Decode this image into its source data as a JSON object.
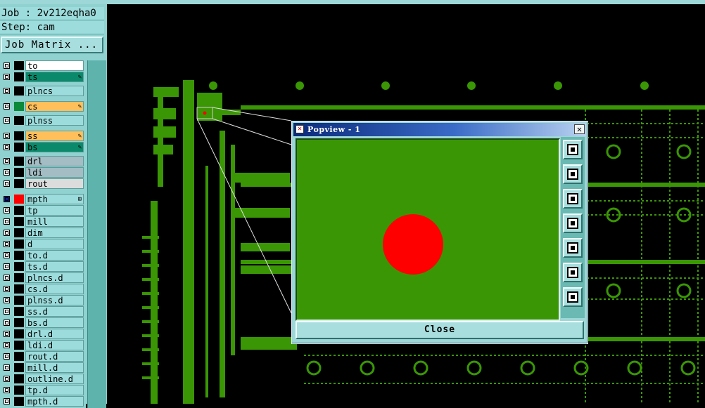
{
  "job_label": "Job : 2v212eqha0",
  "step_label": "Step: cam",
  "job_matrix_button": "Job Matrix ...",
  "layers": [
    {
      "name": "to",
      "bg": "#ffffff",
      "swatch": "#000000",
      "mark": ""
    },
    {
      "name": "ts",
      "bg": "#0a8a6a",
      "swatch": "#000000",
      "mark": "✎"
    },
    {
      "name": "plncs",
      "bg": "#9ddcdc",
      "swatch": "#000000",
      "mark": ""
    },
    {
      "name": "cs",
      "bg": "#ffbf5a",
      "swatch": "#0a8a3a",
      "mark": "✎"
    },
    {
      "name": "plnss",
      "bg": "#9ddcdc",
      "swatch": "#000000",
      "mark": ""
    },
    {
      "name": "ss",
      "bg": "#ffbf5a",
      "swatch": "#000000",
      "mark": "✎"
    },
    {
      "name": "bs",
      "bg": "#0a8a6a",
      "swatch": "#000000",
      "mark": "✎"
    },
    {
      "name": "drl",
      "bg": "#a4bcc3",
      "swatch": "#000000",
      "mark": ""
    },
    {
      "name": "ldi",
      "bg": "#a4bcc3",
      "swatch": "#000000",
      "mark": ""
    },
    {
      "name": "rout",
      "bg": "#dcdcdc",
      "swatch": "#000000",
      "mark": ""
    },
    {
      "name": "mpth",
      "bg": "#9ddcdc",
      "swatch": "#ff0000",
      "mark": "⊞",
      "selected": true
    },
    {
      "name": "tp",
      "bg": "#9ddcdc",
      "swatch": "#000000",
      "mark": ""
    },
    {
      "name": "mill",
      "bg": "#9ddcdc",
      "swatch": "#000000",
      "mark": ""
    },
    {
      "name": "dim",
      "bg": "#9ddcdc",
      "swatch": "#000000",
      "mark": ""
    },
    {
      "name": "d",
      "bg": "#9ddcdc",
      "swatch": "#000000",
      "mark": ""
    },
    {
      "name": "to.d",
      "bg": "#9ddcdc",
      "swatch": "#000000",
      "mark": ""
    },
    {
      "name": "ts.d",
      "bg": "#9ddcdc",
      "swatch": "#000000",
      "mark": ""
    },
    {
      "name": "plncs.d",
      "bg": "#9ddcdc",
      "swatch": "#000000",
      "mark": ""
    },
    {
      "name": "cs.d",
      "bg": "#9ddcdc",
      "swatch": "#000000",
      "mark": ""
    },
    {
      "name": "plnss.d",
      "bg": "#9ddcdc",
      "swatch": "#000000",
      "mark": ""
    },
    {
      "name": "ss.d",
      "bg": "#9ddcdc",
      "swatch": "#000000",
      "mark": ""
    },
    {
      "name": "bs.d",
      "bg": "#9ddcdc",
      "swatch": "#000000",
      "mark": ""
    },
    {
      "name": "drl.d",
      "bg": "#9ddcdc",
      "swatch": "#000000",
      "mark": ""
    },
    {
      "name": "ldi.d",
      "bg": "#9ddcdc",
      "swatch": "#000000",
      "mark": ""
    },
    {
      "name": "rout.d",
      "bg": "#9ddcdc",
      "swatch": "#000000",
      "mark": ""
    },
    {
      "name": "mill.d",
      "bg": "#9ddcdc",
      "swatch": "#000000",
      "mark": ""
    },
    {
      "name": "outline.d",
      "bg": "#9ddcdc",
      "swatch": "#000000",
      "mark": ""
    },
    {
      "name": "tp.d",
      "bg": "#9ddcdc",
      "swatch": "#000000",
      "mark": ""
    },
    {
      "name": "mpth.d",
      "bg": "#9ddcdc",
      "swatch": "#000000",
      "mark": ""
    }
  ],
  "popup": {
    "title": "Popview - 1",
    "close_label": "Close",
    "tools": [
      "zoom-fit-icon",
      "pan-up-icon",
      "pan-down-icon",
      "pan-left-icon",
      "pan-right-icon",
      "zoom-in-icon",
      "zoom-out-icon"
    ]
  },
  "colors": {
    "board_bg": "#000000",
    "copper": "#3a9604",
    "pad": "#ff0000",
    "panel": "#8fd2cf"
  }
}
